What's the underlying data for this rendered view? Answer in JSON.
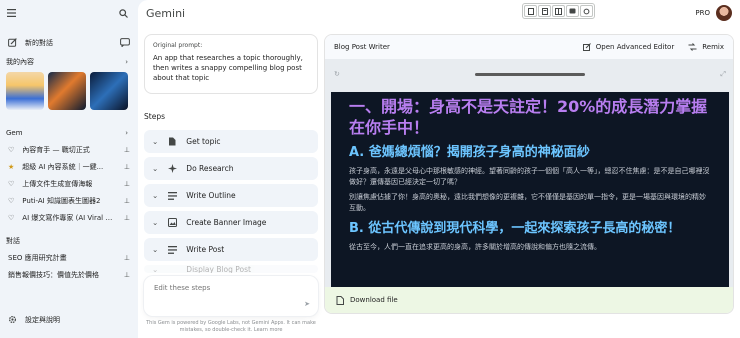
{
  "sidebar": {
    "new_chat_label": "新的對話",
    "my_content_label": "我的內容",
    "gem_section_label": "Gem",
    "gems": [
      {
        "icon": "heart-icon",
        "label": "內容育手 — 戰切正式"
      },
      {
        "icon": "star-icon",
        "label": "超級 AI 內容系統｜一鍵..."
      },
      {
        "icon": "heart-icon",
        "label": "上傳文件生成宣傳海報"
      },
      {
        "icon": "heart-icon",
        "label": "Puti-AI 知識圖表生圖器2"
      },
      {
        "icon": "heart-icon",
        "label": "AI 爆文寫作專家 (AI Viral Cop..."
      }
    ],
    "chats_section_label": "對話",
    "chats": [
      {
        "label": "SEO 應用研究計畫"
      },
      {
        "label": "銷售報價技巧：價值先於價格"
      }
    ],
    "settings_label": "設定與說明"
  },
  "header": {
    "brand": "Gemini",
    "badge": "PRO"
  },
  "prompt": {
    "label": "Original prompt:",
    "text": "An app that researches a topic thoroughly, then writes a snappy compelling blog post about that topic"
  },
  "steps": {
    "title": "Steps",
    "items": [
      {
        "icon": "document-icon",
        "label": "Get topic"
      },
      {
        "icon": "sparkle-icon",
        "label": "Do Research"
      },
      {
        "icon": "list-icon",
        "label": "Write Outline"
      },
      {
        "icon": "image-icon",
        "label": "Create Banner Image"
      },
      {
        "icon": "list-icon",
        "label": "Write Post"
      },
      {
        "icon": "list-icon",
        "label": "Display Blog Post"
      }
    ]
  },
  "editor": {
    "placeholder": "Edit these steps",
    "disclaimer": "This Gem is powered by Google Labs, not Gemini Apps. It can make mistakes, so double-check it. Learn more"
  },
  "preview": {
    "title": "Blog Post Writer",
    "open_editor_label": "Open Advanced Editor",
    "remix_label": "Remix",
    "heading1": "一、開場：身高不是天註定！20%的成長潛力掌握在你手中！",
    "heading2a": "A. 爸媽總煩惱？揭開孩子身高的神秘面紗",
    "para1": "孩子身高，永遠是父母心中那根敏感的神經。望著同齡的孩子一個個「高人一等」，總忍不住焦慮：是不是自己哪裡沒做好？還傳基因已經決定一切了嗎？",
    "para2": "別讓焦慮佔據了你！身高的奧秘，遠比我們想像的更複雜，它不僅僅是基因的單一指令，更是一場基因與環境的精妙互動。",
    "heading2b": "B. 從古代傳說到現代科學，一起來探索孩子長高的秘密！",
    "para3": "從古至今，人們一直在追求更高的身高，許多關於增高的傳說和偏方也隨之流傳。",
    "download_label": "Download file"
  },
  "colors": {
    "heading1": "#b87ef0",
    "heading2": "#6cc5ff",
    "canvas_bg": "#0d1624",
    "download_bg": "#edf7e4"
  }
}
